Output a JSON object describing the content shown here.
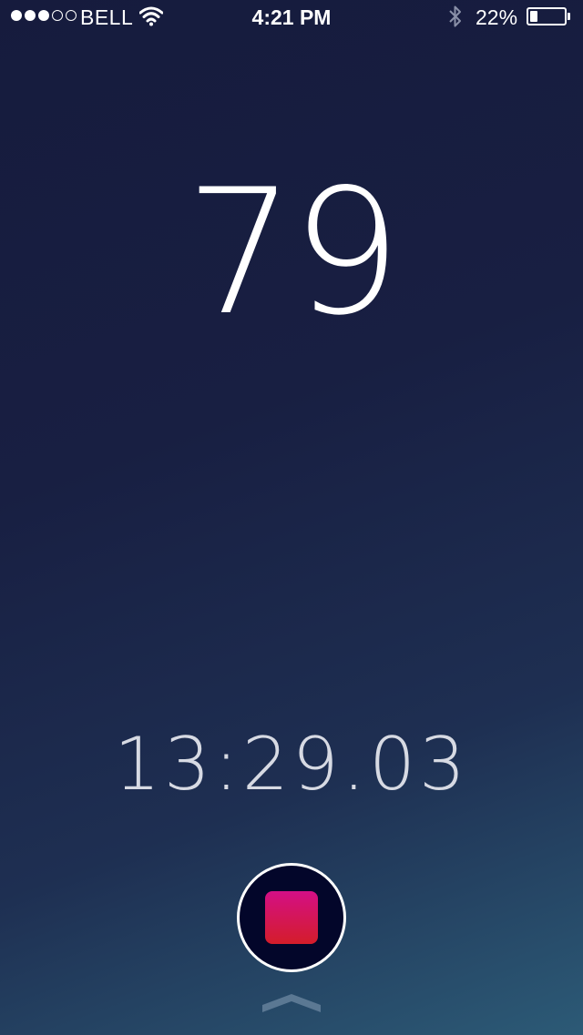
{
  "status_bar": {
    "signal_bars_full": 3,
    "signal_bars_total": 5,
    "carrier": "BELL",
    "time": "4:21 PM",
    "battery_percent": "22%",
    "battery_level": 0.22,
    "icons": [
      "wifi-icon",
      "bluetooth-icon",
      "battery-icon"
    ]
  },
  "main": {
    "count": "79",
    "elapsed_time": "13:29.03"
  },
  "controls": {
    "stop_icon": "stop-icon",
    "swipe_icon": "chevron-up-icon"
  },
  "colors": {
    "background_top": "#161b3d",
    "background_bottom": "#2c5a76",
    "stop_button_fill": "#03062a",
    "stop_square_top": "#d40f86",
    "stop_square_bottom": "#d41d2a",
    "chevron": "#5b7893"
  }
}
